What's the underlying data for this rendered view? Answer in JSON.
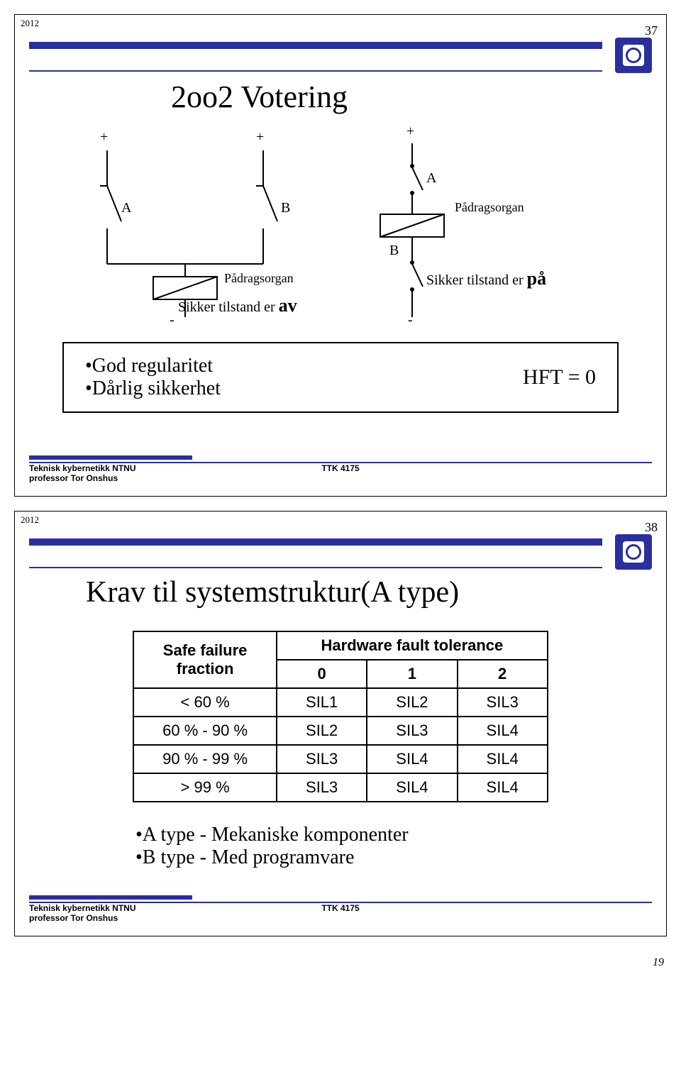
{
  "slide1": {
    "year": "2012",
    "page": "37",
    "title": "2oo2 Votering",
    "plus": "+",
    "minus": "-",
    "labelA": "A",
    "labelB": "B",
    "actuator": "Pådragsorgan",
    "state_prefix": "Sikker tilstand er",
    "state_off": "av",
    "state_on": "på",
    "bullet1": "•God  regularitet",
    "bullet2": "•Dårlig sikkerhet",
    "hft": "HFT = 0",
    "footer_l1": "Teknisk kybernetikk NTNU",
    "footer_l2": "professor Tor Onshus",
    "footer_mid": "TTK 4175"
  },
  "slide2": {
    "year": "2012",
    "page": "38",
    "title": "Krav til systemstruktur(A type)",
    "th_sff_l1": "Safe failure",
    "th_sff_l2": "fraction",
    "th_hft": "Hardware fault tolerance",
    "hcol0": "0",
    "hcol1": "1",
    "hcol2": "2",
    "rows": [
      {
        "r": "< 60 %",
        "c0": "SIL1",
        "c1": "SIL2",
        "c2": "SIL3"
      },
      {
        "r": "60 % - 90 %",
        "c0": "SIL2",
        "c1": "SIL3",
        "c2": "SIL4"
      },
      {
        "r": "90 % - 99 %",
        "c0": "SIL3",
        "c1": "SIL4",
        "c2": "SIL4"
      },
      {
        "r": "> 99 %",
        "c0": "SIL3",
        "c1": "SIL4",
        "c2": "SIL4"
      }
    ],
    "bullet1": "•A type - Mekaniske komponenter",
    "bullet2": "•B type - Med programvare",
    "footer_l1": "Teknisk kybernetikk NTNU",
    "footer_l2": "professor Tor Onshus",
    "footer_mid": "TTK 4175"
  },
  "chart_data": {
    "type": "table",
    "title": "Krav til systemstruktur(A type)",
    "row_header": "Safe failure fraction",
    "col_header": "Hardware fault tolerance",
    "columns": [
      "0",
      "1",
      "2"
    ],
    "rows": [
      "< 60 %",
      "60 % - 90 %",
      "90 % - 99 %",
      "> 99 %"
    ],
    "values": [
      [
        "SIL1",
        "SIL2",
        "SIL3"
      ],
      [
        "SIL2",
        "SIL3",
        "SIL4"
      ],
      [
        "SIL3",
        "SIL4",
        "SIL4"
      ],
      [
        "SIL3",
        "SIL4",
        "SIL4"
      ]
    ]
  },
  "page_num": "19"
}
